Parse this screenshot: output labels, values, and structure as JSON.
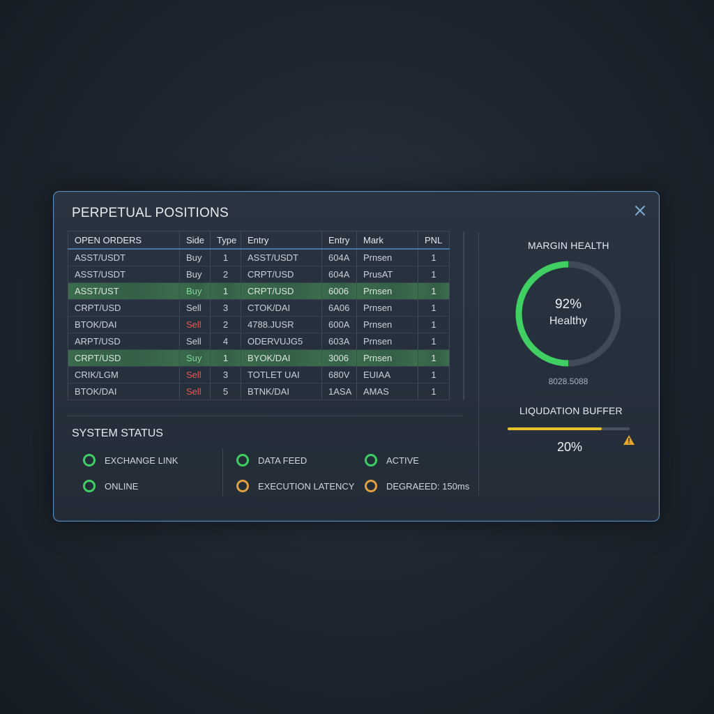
{
  "panel": {
    "title": "PERPETUAL POSITIONS"
  },
  "orders": {
    "headers": [
      "OPEN ORDERS",
      "Side",
      "Type",
      "Entry",
      "Entry",
      "Mark",
      "PNL"
    ],
    "rows": [
      {
        "pair": "ASST/USDT",
        "side": "Buy",
        "type": "1",
        "entry": "ASST/USDT",
        "entry2": "604A",
        "mark": "Prnsen",
        "pnl": "1",
        "highlight": false,
        "side_red": false
      },
      {
        "pair": "ASST/USDT",
        "side": "Buy",
        "type": "2",
        "entry": "CRPT/USD",
        "entry2": "604A",
        "mark": "PrusAT",
        "pnl": "1",
        "highlight": false,
        "side_red": false
      },
      {
        "pair": "ASST/UST",
        "side": "Buy",
        "type": "1",
        "entry": "CRPT/USD",
        "entry2": "6006",
        "mark": "Prnsen",
        "pnl": "1",
        "highlight": true,
        "side_red": false
      },
      {
        "pair": "CRPT/USD",
        "side": "Sell",
        "type": "3",
        "entry": "CTOK/DAI",
        "entry2": "6A06",
        "mark": "Prnsen",
        "pnl": "1",
        "highlight": false,
        "side_red": false
      },
      {
        "pair": "BTOK/DAI",
        "side": "Sell",
        "type": "2",
        "entry": "4788.JUSR",
        "entry2": "600A",
        "mark": "Prnsen",
        "pnl": "1",
        "highlight": false,
        "side_red": true
      },
      {
        "pair": "ARPT/USD",
        "side": "Sell",
        "type": "4",
        "entry": "ODERVUJG5",
        "entry2": "603A",
        "mark": "Prnsen",
        "pnl": "1",
        "highlight": false,
        "side_red": false
      },
      {
        "pair": "CRPT/USD",
        "side": "Suy",
        "type": "1",
        "entry": "BYOK/DAI",
        "entry2": "3006",
        "mark": "Prnsen",
        "pnl": "1",
        "highlight": true,
        "side_red": false
      },
      {
        "pair": "CRIK/LGM",
        "side": "Sell",
        "type": "3",
        "entry": "TOTLET UAI",
        "entry2": "680V",
        "mark": "EUIAA",
        "pnl": "1",
        "highlight": false,
        "side_red": true
      },
      {
        "pair": "BTOK/DAI",
        "side": "Sell",
        "type": "5",
        "entry": "BTNK/DAI",
        "entry2": "1ASA",
        "mark": "AMAS",
        "pnl": "1",
        "highlight": false,
        "side_red": true
      }
    ]
  },
  "system_status": {
    "title": "SYSTEM STATUS",
    "items": [
      {
        "label": "EXCHANGE LINK",
        "state": "ok",
        "icon": "status-ok-icon"
      },
      {
        "label": "ONLINE",
        "state": "ok",
        "icon": "status-ok-icon"
      },
      {
        "label": "DATA FEED",
        "state": "ok",
        "icon": "status-ok-icon"
      },
      {
        "label": "EXECUTION LATENCY",
        "state": "warn",
        "icon": "status-warn-icon"
      },
      {
        "label": "ACTIVE",
        "state": "ok",
        "icon": "status-ok-icon"
      },
      {
        "label": "DEGRAEED: 150ms",
        "state": "warn",
        "icon": "status-warn-icon"
      }
    ]
  },
  "margin_health": {
    "title": "MARGIN HEALTH",
    "percent_text": "92%",
    "level": 0.5,
    "status": "Healthy",
    "value": "8028.5088"
  },
  "liquidation_buffer": {
    "title": "LIQUDATION BUFFER",
    "percent_text": "20%",
    "level": 0.77,
    "warning_icon": "warning-triangle-icon"
  },
  "colors": {
    "accent_border": "#5b8fc0",
    "ok": "#3fcf63",
    "warn": "#e0a040",
    "sell_red": "#e05a57",
    "gauge_green": "#3fcf63",
    "gauge_track": "#414b57",
    "buffer_yellow": "#e6c22b"
  }
}
